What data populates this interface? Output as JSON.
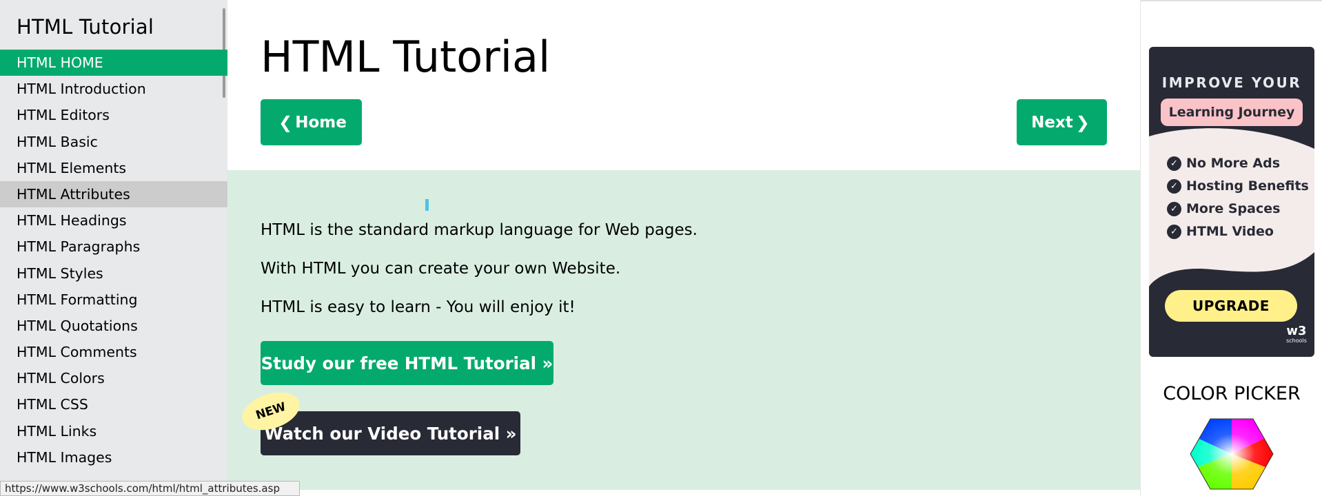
{
  "sidebar": {
    "title": "HTML Tutorial",
    "items": [
      {
        "label": "HTML HOME",
        "state": "active"
      },
      {
        "label": "HTML Introduction",
        "state": ""
      },
      {
        "label": "HTML Editors",
        "state": ""
      },
      {
        "label": "HTML Basic",
        "state": ""
      },
      {
        "label": "HTML Elements",
        "state": ""
      },
      {
        "label": "HTML Attributes",
        "state": "hover"
      },
      {
        "label": "HTML Headings",
        "state": ""
      },
      {
        "label": "HTML Paragraphs",
        "state": ""
      },
      {
        "label": "HTML Styles",
        "state": ""
      },
      {
        "label": "HTML Formatting",
        "state": ""
      },
      {
        "label": "HTML Quotations",
        "state": ""
      },
      {
        "label": "HTML Comments",
        "state": ""
      },
      {
        "label": "HTML Colors",
        "state": ""
      },
      {
        "label": "HTML CSS",
        "state": ""
      },
      {
        "label": "HTML Links",
        "state": ""
      },
      {
        "label": "HTML Images",
        "state": ""
      }
    ]
  },
  "status_bar": {
    "url": "https://www.w3schools.com/html/html_attributes.asp"
  },
  "main": {
    "title": "HTML Tutorial",
    "home_label": "Home",
    "next_label": "Next",
    "intro_lines": [
      "HTML is the standard markup language for Web pages.",
      "With HTML you can create your own Website.",
      "HTML is easy to learn - You will enjoy it!"
    ],
    "study_button": "Study our free HTML Tutorial »",
    "video_button": "Watch our Video Tutorial »",
    "new_badge": "NEW"
  },
  "ad": {
    "heading": "IMPROVE YOUR",
    "subheading": "Learning Journey",
    "features": [
      "No More Ads",
      "Hosting Benefits",
      "More Spaces",
      "HTML Video"
    ],
    "cta": "UPGRADE",
    "logo_mark": "w3",
    "logo_text": "schools"
  },
  "color_picker": {
    "title": "COLOR PICKER"
  },
  "colors": {
    "accent": "#04aa6d",
    "sidebar_bg": "#e7e9eb",
    "hover_bg": "#cccccc",
    "panel_bg": "#d9eee1",
    "dark": "#282a35",
    "badge_yellow": "#fff4a3",
    "ad_pink": "#f9c3c8"
  },
  "icons": {
    "prev": "chevron-left-icon",
    "next": "chevron-right-icon",
    "check": "check-circle-icon"
  }
}
